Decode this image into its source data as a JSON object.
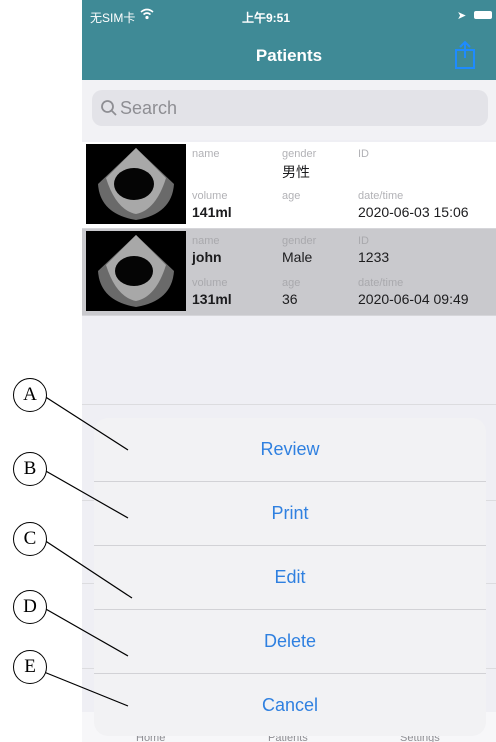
{
  "status_bar": {
    "carrier": "无SIM卡",
    "time": "上午9:51"
  },
  "nav": {
    "title": "Patients",
    "share_icon": "share-icon"
  },
  "search": {
    "placeholder": "Search"
  },
  "patients": [
    {
      "name_label": "name",
      "name": "",
      "gender_label": "gender",
      "gender": "男性",
      "id_label": "ID",
      "id": "",
      "volume_label": "volume",
      "volume": "141ml",
      "age_label": "age",
      "age": "",
      "datetime_label": "date/time",
      "datetime": "2020-06-03 15:06",
      "selected": false
    },
    {
      "name_label": "name",
      "name": "john",
      "gender_label": "gender",
      "gender": "Male",
      "id_label": "ID",
      "id": "1233",
      "volume_label": "volume",
      "volume": "131ml",
      "age_label": "age",
      "age": "36",
      "datetime_label": "date/time",
      "datetime": "2020-06-04 09:49",
      "selected": true
    }
  ],
  "action_sheet": {
    "review": "Review",
    "print": "Print",
    "edit": "Edit",
    "delete": "Delete",
    "cancel": "Cancel"
  },
  "tab_bar": {
    "home": "Home",
    "patients": "Patients",
    "settings": "Settings"
  },
  "callouts": {
    "a": "A",
    "b": "B",
    "c": "C",
    "d": "D",
    "e": "E"
  },
  "colors": {
    "nav_bar": "#3f8a96",
    "action_text": "#2f80e0"
  }
}
